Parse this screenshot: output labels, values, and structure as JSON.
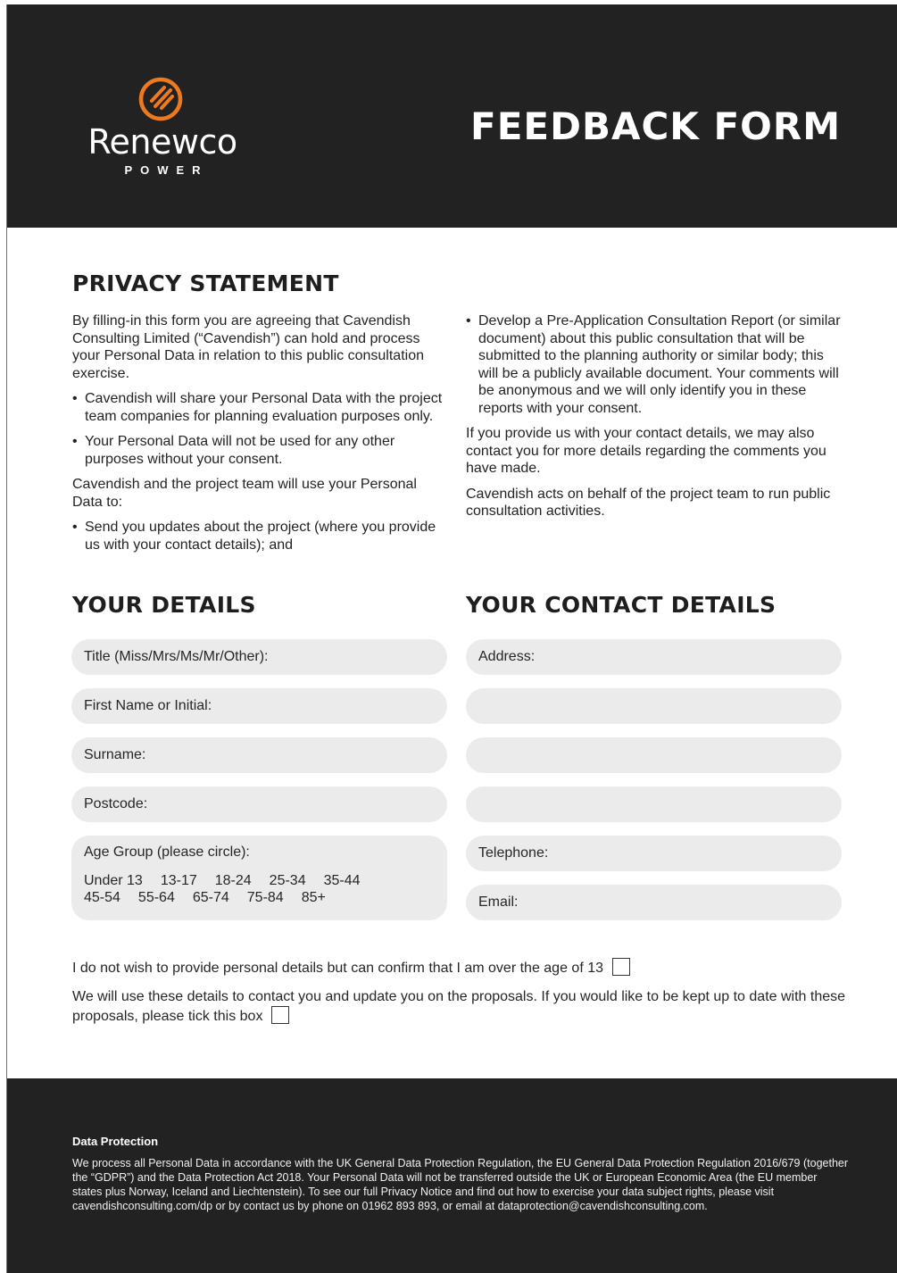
{
  "header": {
    "logo_name": "Renewco",
    "logo_sub": "POWER",
    "title": "FEEDBACK FORM",
    "logo_color": "#ee7a1f"
  },
  "privacy": {
    "heading": "PRIVACY STATEMENT",
    "intro": "By filling-in this form you are agreeing that Cavendish Consulting Limited (“Cavendish”) can hold and process your Personal Data in relation to this public consultation exercise.",
    "bullet1": "Cavendish will share your Personal Data with the project team companies for planning evaluation purposes only.",
    "bullet2": "Your Personal Data will not be used for any other purposes without your consent.",
    "use_intro": "Cavendish and the project team will use your Personal Data to:",
    "bullet3": "Send you updates about the project (where you provide us with your contact details); and",
    "bullet4": "Develop a Pre-Application Consultation Report (or similar document) about this public consultation that will be submitted to the planning authority or similar body; this will be a publicly available document. Your comments will be anonymous and we will only identify you in these reports with your consent.",
    "contact_para": "If you provide us with your contact details, we may also contact you for more details regarding the comments you have made.",
    "behalf_para": "Cavendish acts on behalf of the project team to run public consultation activities."
  },
  "your_details": {
    "heading": "YOUR DETAILS",
    "title_field": "Title (Miss/Mrs/Ms/Mr/Other):",
    "first_name_field": "First Name or Initial:",
    "surname_field": "Surname:",
    "postcode_field": "Postcode:",
    "age_label": "Age Group (please circle):",
    "age_row1": [
      "Under 13",
      "13-17",
      "18-24",
      "25-34",
      "35-44"
    ],
    "age_row2": [
      "45-54",
      "55-64",
      "65-74",
      "75-84",
      "85+"
    ]
  },
  "contact_details": {
    "heading": "YOUR CONTACT DETAILS",
    "address_field": "Address:",
    "telephone_field": "Telephone:",
    "email_field": "Email:"
  },
  "confirm": {
    "age_confirm": "I do not wish to provide personal details but can confirm that I am over the age of 13",
    "updates_text": "We will use these details to contact you and update you on the proposals. If you would like to be kept up to date with these proposals, please tick this box"
  },
  "footer": {
    "title": "Data Protection",
    "text": "We process all Personal Data in accordance with the UK General Data Protection Regulation, the EU General Data Protection Regulation 2016/679 (together the “GDPR”) and the Data Protection Act 2018. Your Personal Data will not be transferred outside the UK or European Economic Area (the EU member states plus Norway, Iceland and Liechtenstein). To see our full Privacy Notice and find out how to exercise your data subject rights, please visit cavendishconsulting.com/dp or by contact us by phone on 01962 893 893, or email at dataprotection@cavendishconsulting.com."
  }
}
